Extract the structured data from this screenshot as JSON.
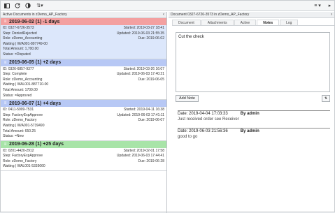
{
  "toolbar": {
    "icons": [
      "layout-icon",
      "refresh-icon",
      "toggle-icon",
      "sort-icon"
    ],
    "sort_caret": "▾",
    "right_menu": "≡ ▾"
  },
  "left": {
    "title": "Active Documents in zDemo_AP_Factory",
    "groups": [
      {
        "label": "2019-06-02 (1) -1 days",
        "color": "#f3a0a0",
        "cards": [
          {
            "id": "ID: 0327-6726-3573",
            "started": "Started: 2019-03-27 18:41",
            "step": "Step: DeniedRejected",
            "updated": "Updated: 2019-06-03 21:55:35",
            "role": "Role: zDemo_Accounting",
            "due": "Due: 2019-06-02",
            "waiting": "Waiting | W/A001-897749-00",
            "total": "Total Amount: 1,700.00",
            "status": "Status: =Disputed",
            "selected": true
          }
        ]
      },
      {
        "label": "2019-06-05 (1) +2 days",
        "color": "#b7c8f5",
        "cards": [
          {
            "id": "ID: 0326-6857-9377",
            "started": "Started: 2019-03-26 16:07",
            "step": "Step: Complete",
            "updated": "Updated: 2019-06-03 17:40:21",
            "role": "Role: zDemo_Accounting",
            "due": "Due: 2019-06-05",
            "waiting": "Waiting | WAL001-887710-00",
            "total": "Total Amount: 1700.00",
            "status": "Status: =Approved",
            "selected": false
          }
        ]
      },
      {
        "label": "2019-06-07 (1) +4 days",
        "color": "#b7c8f5",
        "cards": [
          {
            "id": "ID: 0411-5909-7531",
            "started": "Started: 2019-04-11 16:38",
            "step": "Step: FactoryExpApprove",
            "updated": "Updated: 2019-06-03 17:41:11",
            "role": "Role: zDemo_Factory",
            "due": "Due: 2019-06-07",
            "waiting": "Waiting | W/A001-5739490",
            "total": "Total Amount: 650.25",
            "status": "Status: =New",
            "selected": false
          }
        ]
      },
      {
        "label": "2019-06-28 (1) +25 days",
        "color": "#a8e4a8",
        "cards": [
          {
            "id": "ID: 0201-4420-2912",
            "started": "Started: 2019-02-01 17:58",
            "step": "Step: FactoryExpApprove",
            "updated": "Updated: 2019-06-03 17:44:41",
            "role": "Role: zDemo_Factory",
            "due": "Due: 2019-06-28",
            "waiting": "Waiting | WAL001-5335060",
            "total": "",
            "status": "",
            "selected": false
          }
        ]
      }
    ]
  },
  "right": {
    "title": "Document 0327-6726-3573 in zDemo_AP_Factory",
    "tabs": [
      "Document",
      "Attachments",
      "Active",
      "Notes",
      "Log"
    ],
    "active_tab": "Notes",
    "note_text": "Cut the check",
    "add_note_label": "Add Note",
    "notes": [
      {
        "date": "Date: 2019-04-04 17:03:33",
        "by": "By admin",
        "text": "Just received order see Receiver"
      },
      {
        "date": "Date: 2019-06-03 21:56:36",
        "by": "By admin",
        "text": "good to go"
      }
    ]
  }
}
